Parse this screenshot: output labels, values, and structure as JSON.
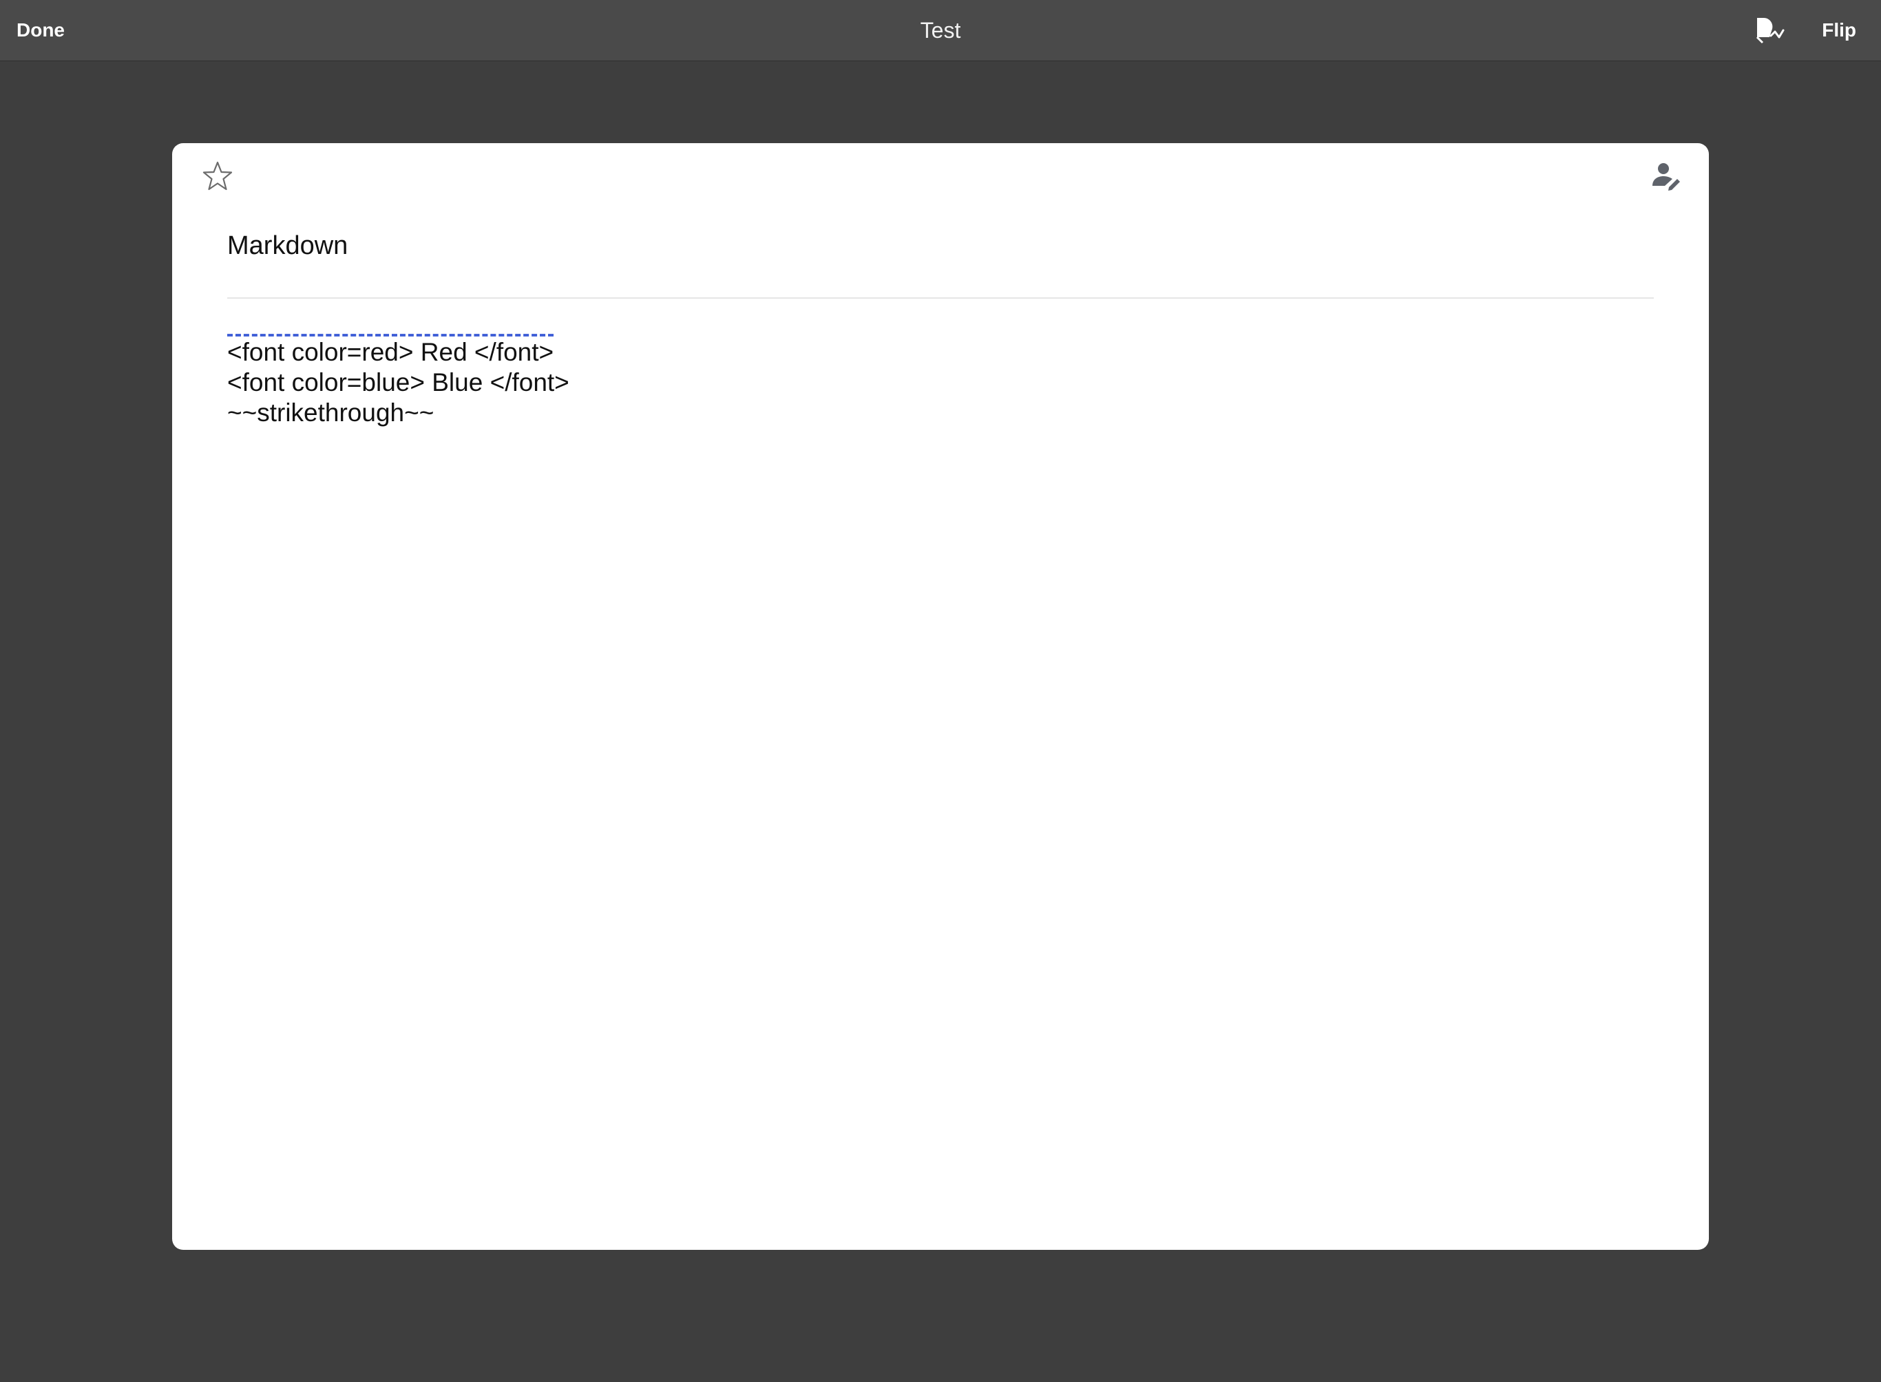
{
  "toolbar": {
    "done_label": "Done",
    "title": "Test",
    "share_icon": "share-icon",
    "flip_label": "Flip"
  },
  "card": {
    "star_icon": "star-icon",
    "editor_icon": "person-edit-icon",
    "field_name": "Markdown",
    "content_lines": [
      "<font color=red> Red </font>",
      "<font color=blue> Blue </font>",
      "~~strikethrough~~"
    ]
  },
  "colors": {
    "page_background": "#3e3e3e",
    "toolbar_background": "#4a4a4a",
    "card_background": "#ffffff",
    "icon_gray": "#666666",
    "spell_underline": "#3b5bd6"
  }
}
